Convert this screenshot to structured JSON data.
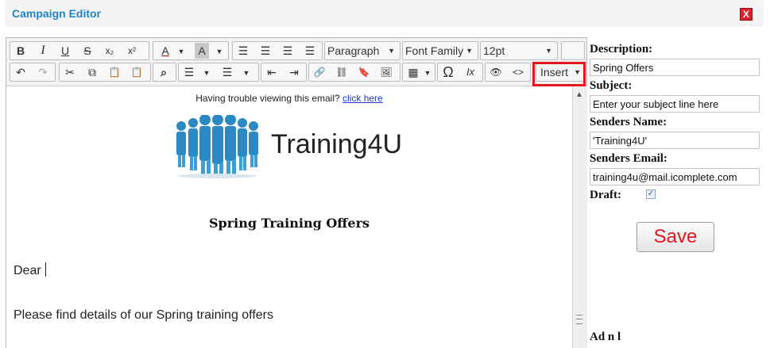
{
  "window": {
    "title": "Campaign Editor",
    "close": "X"
  },
  "toolbar": {
    "row1": {
      "bold": "B",
      "italic": "I",
      "underline": "U",
      "strike": "S",
      "subscript": "x₂",
      "superscript": "x²",
      "text_color": "A",
      "bg_color": "A",
      "format_select": "Paragraph",
      "font_family_select": "Font Family",
      "font_size_select": "12pt"
    },
    "row2": {
      "undo": "↶",
      "redo": "↷",
      "cut": "✂",
      "copy": "⧉",
      "paste": "📋",
      "paste_text": "📋",
      "find": "⌕",
      "bullet_list": "☰",
      "numbered_list": "☰",
      "outdent": "⇤",
      "indent": "⇥",
      "link": "🔗",
      "unlink": "⛓",
      "anchor": "🔖",
      "image": "🖼",
      "table": "▦",
      "special_char": "Ω",
      "clear_format": "Ix",
      "preview": "👁",
      "source": "<>",
      "insert_menu": "Insert"
    }
  },
  "content": {
    "trouble_text": "Having trouble viewing this email?",
    "trouble_link": "click here",
    "logo_text": "Training4U",
    "headline": "Spring Training Offers",
    "greeting": "Dear",
    "details": "Please find details of our Spring training offers"
  },
  "form": {
    "description_label": "Description:",
    "description_value": "Spring Offers",
    "subject_label": "Subject:",
    "subject_value": "Enter your subject line here",
    "sender_name_label": "Senders Name:",
    "sender_name_value": "'Training4U'",
    "sender_email_label": "Senders Email:",
    "sender_email_value": "training4u@mail.icomplete.com",
    "draft_label": "Draft:",
    "draft_checked": true,
    "save_label": "Save",
    "partial_label": "Ad   n   l"
  },
  "colors": {
    "title_blue": "#1e84c8",
    "highlight_red": "#e3161f",
    "save_text": "#e3161f"
  }
}
